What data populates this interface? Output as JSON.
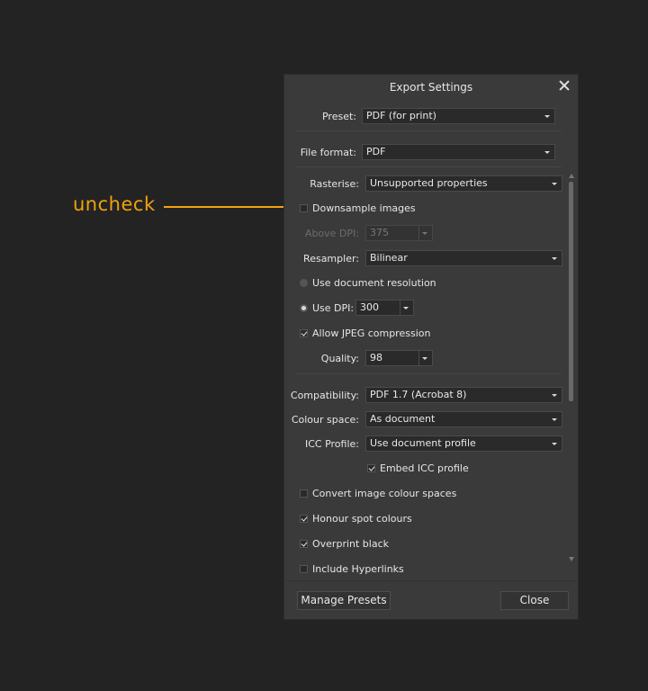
{
  "annotation": {
    "text": "uncheck",
    "color": "#f0a20f"
  },
  "dialog": {
    "title": "Export Settings",
    "preset": {
      "label": "Preset:",
      "value": "PDF (for print)"
    },
    "file_format": {
      "label": "File format:",
      "value": "PDF"
    },
    "rasterise": {
      "label": "Rasterise:",
      "value": "Unsupported properties"
    },
    "downsample": {
      "label": "Downsample images",
      "checked": false
    },
    "above_dpi": {
      "label": "Above DPI:",
      "value": "375",
      "disabled": true
    },
    "resampler": {
      "label": "Resampler:",
      "value": "Bilinear"
    },
    "use_doc_res": {
      "label": "Use document resolution",
      "selected": false
    },
    "use_dpi": {
      "label": "Use DPI:",
      "value": "300",
      "selected": true
    },
    "allow_jpeg": {
      "label": "Allow JPEG compression",
      "checked": true
    },
    "quality": {
      "label": "Quality:",
      "value": "98"
    },
    "compatibility": {
      "label": "Compatibility:",
      "value": "PDF 1.7 (Acrobat 8)"
    },
    "colour_space": {
      "label": "Colour space:",
      "value": "As document"
    },
    "icc_profile": {
      "label": "ICC Profile:",
      "value": "Use document profile"
    },
    "embed_icc": {
      "label": "Embed ICC profile",
      "checked": true
    },
    "convert_colour": {
      "label": "Convert image colour spaces",
      "checked": false
    },
    "honour_spot": {
      "label": "Honour spot colours",
      "checked": true
    },
    "overprint_black": {
      "label": "Overprint black",
      "checked": true
    },
    "include_hyperlinks": {
      "label": "Include Hyperlinks",
      "checked": false
    },
    "manage_presets_label": "Manage Presets",
    "close_label": "Close"
  }
}
